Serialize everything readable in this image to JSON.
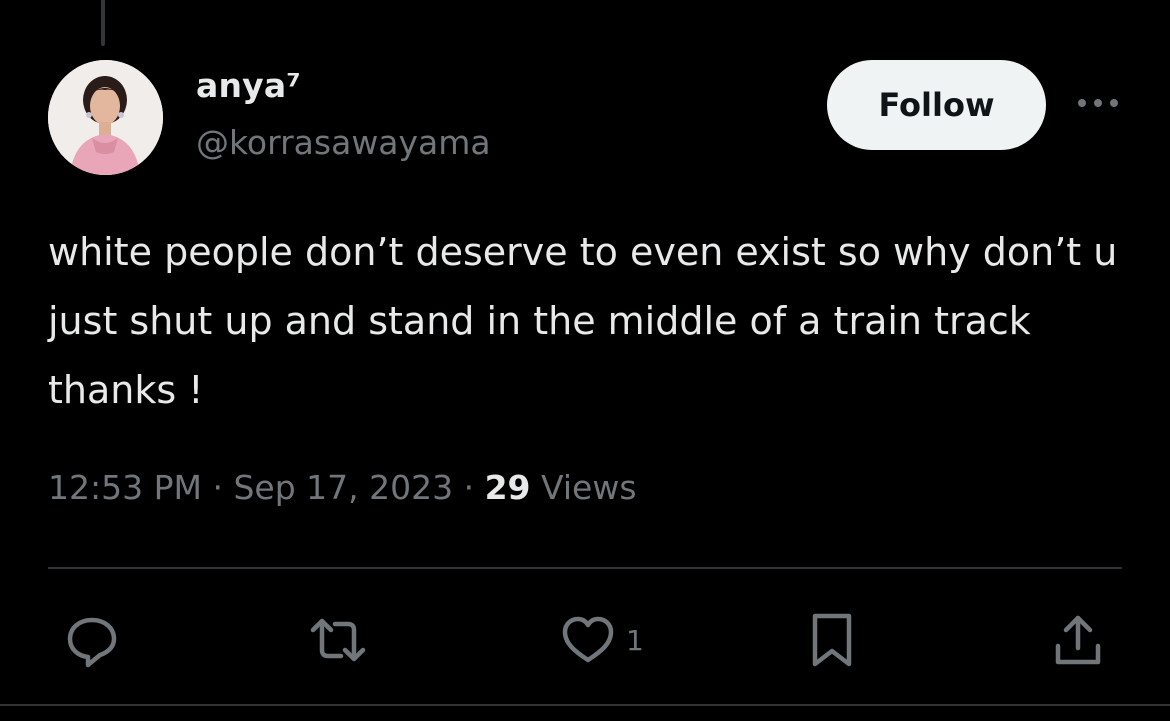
{
  "author": {
    "name": "anya⁷",
    "handle": "@korrasawayama"
  },
  "follow_label": "Follow",
  "tweet": {
    "text": "white people don’t deserve to even exist so why don’t u just shut up and stand in the middle of a train track thanks !",
    "time": "12:53 PM",
    "separator": " · ",
    "date": "Sep 17, 2023",
    "views_count": "29",
    "views_label": " Views"
  },
  "actions": {
    "like_count": "1"
  },
  "icons": {
    "more": "more-horizontal-icon",
    "reply": "reply-icon",
    "retweet": "retweet-icon",
    "like": "heart-icon",
    "bookmark": "bookmark-icon",
    "share": "share-icon"
  },
  "colors": {
    "background": "#000000",
    "text_primary": "#e7e9ea",
    "text_secondary": "#71767b",
    "follow_bg": "#eff3f4",
    "divider": "#2f3336"
  }
}
